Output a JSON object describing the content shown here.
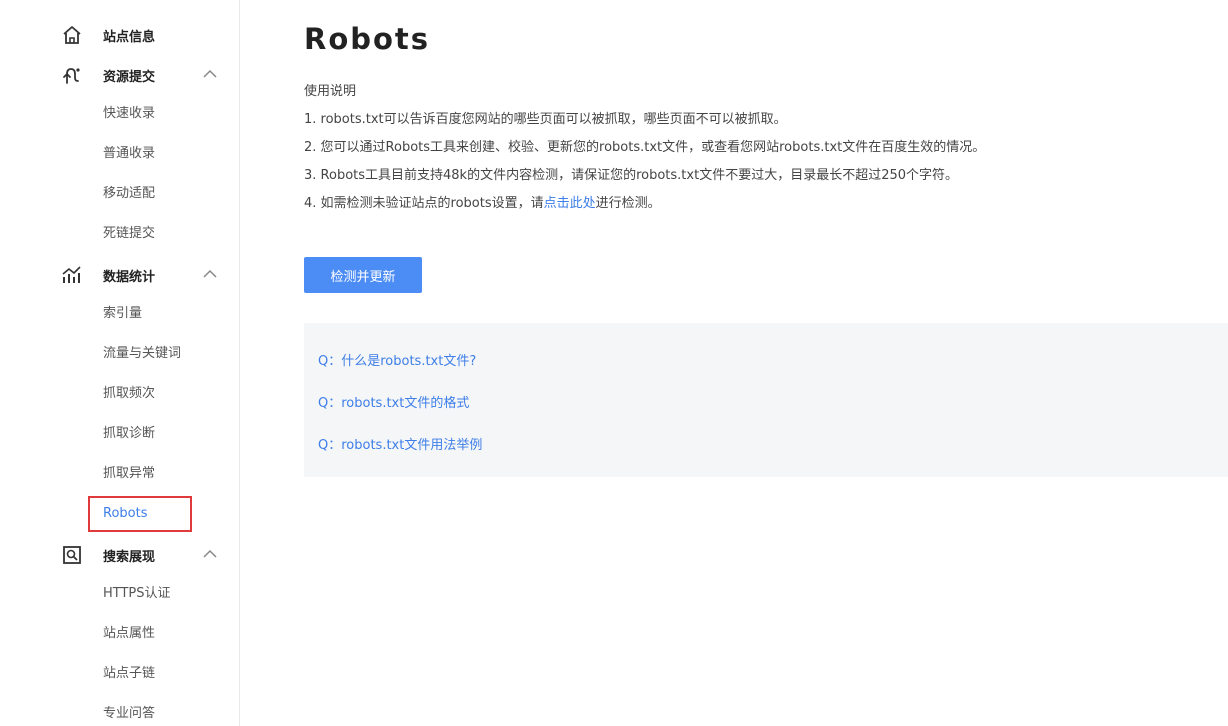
{
  "sidebar": {
    "groups": [
      {
        "label": "站点信息",
        "icon": "home-icon",
        "expanded": null
      },
      {
        "label": "资源提交",
        "icon": "submit-icon",
        "expanded": true
      },
      {
        "label": "数据统计",
        "icon": "stats-icon",
        "expanded": true
      },
      {
        "label": "搜索展现",
        "icon": "search-display-icon",
        "expanded": true
      }
    ],
    "resource_items": [
      "快速收录",
      "普通收录",
      "移动适配",
      "死链提交"
    ],
    "stats_items": [
      "索引量",
      "流量与关键词",
      "抓取频次",
      "抓取诊断",
      "抓取异常",
      "Robots"
    ],
    "search_items": [
      "HTTPS认证",
      "站点属性",
      "站点子链",
      "专业问答"
    ],
    "active_item": "Robots"
  },
  "main": {
    "title": "Robots",
    "usage_title": "使用说明",
    "usage_lines": [
      "1. robots.txt可以告诉百度您网站的哪些页面可以被抓取，哪些页面不可以被抓取。",
      "2. 您可以通过Robots工具来创建、校验、更新您的robots.txt文件，或查看您网站robots.txt文件在百度生效的情况。",
      "3. Robots工具目前支持48k的文件内容检测，请保证您的robots.txt文件不要过大，目录最长不超过250个字符。"
    ],
    "line4_prefix": "4. 如需检测未验证站点的robots设置，请",
    "line4_link": "点击此处",
    "line4_suffix": "进行检测。",
    "button_label": "检测并更新",
    "faq": [
      "Q：什么是robots.txt文件?",
      "Q：robots.txt文件的格式",
      "Q：robots.txt文件用法举例"
    ]
  },
  "colors": {
    "accent": "#3d7ee8",
    "button": "#4c8cf5",
    "highlight_border": "#e03a3a",
    "faq_bg": "#f5f6f7"
  }
}
